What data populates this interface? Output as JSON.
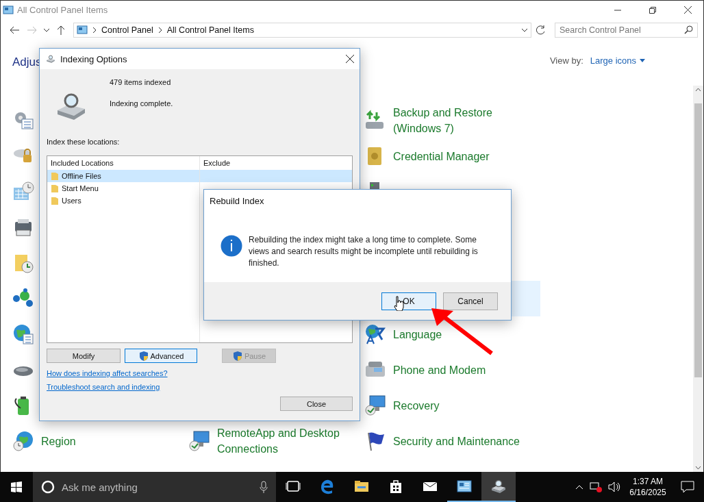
{
  "window": {
    "title": "All Control Panel Items"
  },
  "address_bar": {
    "crumbs": [
      "Control Panel",
      "All Control Panel Items"
    ]
  },
  "search": {
    "placeholder": "Search Control Panel"
  },
  "header": {
    "title": "Adjus",
    "view_by_label": "View by:",
    "view_by_value": "Large icons"
  },
  "columns": [
    [
      {
        "kind": "icon"
      },
      {
        "kind": "icon"
      },
      {
        "kind": "icon"
      },
      {
        "kind": "icon"
      },
      {
        "kind": "icon"
      },
      {
        "kind": "icon"
      },
      {
        "kind": "icon"
      },
      {
        "kind": "icon"
      },
      {
        "kind": "icon"
      },
      {
        "kind": "item",
        "label": "Region"
      }
    ],
    [
      {
        "kind": "covered"
      },
      {
        "kind": "covered"
      },
      {
        "kind": "covered"
      },
      {
        "kind": "covered"
      },
      {
        "kind": "covered"
      },
      {
        "kind": "covered"
      },
      {
        "kind": "covered"
      },
      {
        "kind": "covered"
      },
      {
        "kind": "covered"
      },
      {
        "kind": "item",
        "label": "RemoteApp and Desktop Connections"
      }
    ],
    [
      {
        "kind": "item",
        "label": "Backup and Restore (Windows 7)",
        "hovered": false
      },
      {
        "kind": "item",
        "label": "Credential Manager",
        "hovered": false
      },
      {
        "kind": "icon",
        "hovered": false
      },
      {
        "kind": "covered",
        "hovered": false
      },
      {
        "kind": "covered",
        "hovered": false
      },
      {
        "kind": "covered",
        "hovered": true
      },
      {
        "kind": "item",
        "label": "Language",
        "hovered": false
      },
      {
        "kind": "item",
        "label": "Phone and Modem",
        "hovered": false
      },
      {
        "kind": "item",
        "label": "Recovery",
        "hovered": false
      },
      {
        "kind": "item",
        "label": "Security and Maintenance",
        "hovered": false
      }
    ]
  ],
  "indexing_dialog": {
    "title": "Indexing Options",
    "count": "479 items indexed",
    "status": "Indexing complete.",
    "locations_label": "Index these locations:",
    "columns": [
      "Included Locations",
      "Exclude"
    ],
    "locations": [
      {
        "name": "Offline Files",
        "selected": true
      },
      {
        "name": "Start Menu",
        "selected": false
      },
      {
        "name": "Users",
        "selected": false
      }
    ],
    "buttons": [
      {
        "label": "Modify",
        "shield": false,
        "focused": false,
        "disabled": false
      },
      {
        "label": "Advanced",
        "shield": true,
        "focused": true,
        "disabled": false
      },
      {
        "label": "Pause",
        "shield": true,
        "focused": false,
        "disabled": true
      }
    ],
    "links": [
      "How does indexing affect searches?",
      "Troubleshoot search and indexing"
    ],
    "close": "Close"
  },
  "rebuild_dialog": {
    "title": "Rebuild Index",
    "message": "Rebuilding the index might take a long time to complete. Some views and search results might be incomplete until rebuilding is finished.",
    "buttons": [
      {
        "label": "OK",
        "focused": true
      },
      {
        "label": "Cancel",
        "focused": false
      }
    ]
  },
  "taskbar": {
    "search_placeholder": "Ask me anything",
    "apps": [
      {
        "kind": "taskview",
        "running": false,
        "selected": false
      },
      {
        "kind": "browser",
        "running": false,
        "selected": false
      },
      {
        "kind": "explorer",
        "running": false,
        "selected": false
      },
      {
        "kind": "store",
        "running": false,
        "selected": false
      },
      {
        "kind": "mail",
        "running": false,
        "selected": false
      },
      {
        "kind": "controlpanel",
        "running": true,
        "selected": false
      },
      {
        "kind": "indexer",
        "running": true,
        "selected": true
      }
    ],
    "time": "1:37 AM",
    "date": "6/16/2025"
  }
}
